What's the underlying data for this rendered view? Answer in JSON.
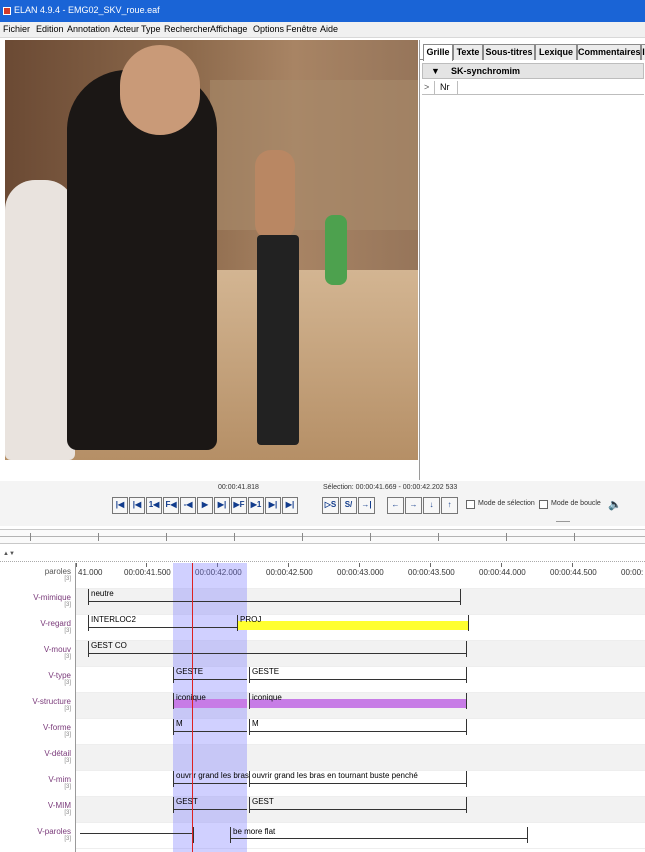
{
  "window": {
    "title": "ELAN 4.9.4 - EMG02_SKV_roue.eaf"
  },
  "menu": [
    {
      "label": "Fichier"
    },
    {
      "label": "Edition"
    },
    {
      "label": "Annotation"
    },
    {
      "label": "Acteur"
    },
    {
      "label": "Type"
    },
    {
      "label": "Rechercher"
    },
    {
      "label": "Affichage"
    },
    {
      "label": "Options"
    },
    {
      "label": "Fenêtre"
    },
    {
      "label": "Aide"
    }
  ],
  "side_panel": {
    "tabs": [
      {
        "label": "Grille",
        "active": true
      },
      {
        "label": "Texte"
      },
      {
        "label": "Sous-titres"
      },
      {
        "label": "Lexique"
      },
      {
        "label": "Commentaires"
      },
      {
        "label": "I"
      }
    ],
    "tier_arrow": "▼",
    "tier_name": "SK-synchromim",
    "grid_pointer": ">",
    "grid_header": "Nr"
  },
  "controls": {
    "current_time": "00:00:41.818",
    "selection": "Sélection: 00:00:41.669 - 00:00:42.202  533",
    "buttons": [
      "|◀",
      "|◀",
      "1◀",
      "F◀",
      "-◀",
      "▶",
      "▶|",
      "▶F",
      "▶1",
      "▶|",
      "▶|",
      "▷S",
      "S/",
      "→|",
      "←",
      "→",
      "↓",
      "↑"
    ],
    "selection_mode_label": "Mode de sélection",
    "loop_mode_label": "Mode de boucle",
    "volume_icon": "speaker-icon"
  },
  "timeline": {
    "ticks": [
      "41.000",
      "00:00:41.500",
      "00:00:42.000",
      "00:00:42.500",
      "00:00:43.000",
      "00:00:43.500",
      "00:00:44.000",
      "00:00:44.500",
      "00:00:"
    ],
    "header_tier": {
      "name": "paroles",
      "count": "[3]"
    },
    "tiers": [
      {
        "name": "V-mimique",
        "count": "[3]"
      },
      {
        "name": "V-regard",
        "count": "[3]"
      },
      {
        "name": "V-mouv",
        "count": "[3]"
      },
      {
        "name": "V-type",
        "count": "[3]"
      },
      {
        "name": "V-structure",
        "count": "[3]"
      },
      {
        "name": "V-forme",
        "count": "[3]"
      },
      {
        "name": "V-détail",
        "count": "[3]"
      },
      {
        "name": "V-mim",
        "count": "[3]"
      },
      {
        "name": "V-MIM",
        "count": "[3]"
      },
      {
        "name": "V-paroles",
        "count": "[3]"
      }
    ],
    "annotations": {
      "mimique": "neutre",
      "regard_1": "INTERLOC2",
      "regard_2": "PROJ",
      "mouv": "GEST CO",
      "type_1": "GESTE",
      "type_2": "GESTE",
      "structure_1": "iconique",
      "structure_2": "iconique",
      "forme_1": "M",
      "forme_2": "M",
      "mim_1": "ouvrir grand les bras",
      "mim_2": "ouvrir grand les bras en tournant buste penché",
      "MIM_1": "GEST",
      "MIM_2": "GEST",
      "paroles_1": "be more flat"
    },
    "colors": {
      "regard_fill": "#ffff30",
      "structure_fill": "#c77ce6",
      "selection": "#8c8cff",
      "cursor": "#dd2222"
    }
  }
}
